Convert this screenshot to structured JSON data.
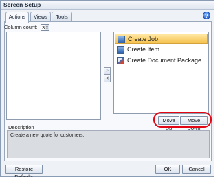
{
  "window": {
    "title": "Screen Setup"
  },
  "help_icon": "?",
  "tabs": [
    {
      "label": "Actions",
      "active": true
    },
    {
      "label": "Views",
      "active": false
    },
    {
      "label": "Tools",
      "active": false
    }
  ],
  "column_count": {
    "label": "Column count:",
    "value": "3"
  },
  "transfer_buttons": {
    "add": ">",
    "remove": "<"
  },
  "actions_list": [
    {
      "label": "Create Job",
      "icon": "create-job-icon",
      "selected": true
    },
    {
      "label": "Create Item",
      "icon": "create-item-icon",
      "selected": false
    },
    {
      "label": "Create Document Package",
      "icon": "document-package-icon",
      "selected": false
    }
  ],
  "order_buttons": {
    "move_up": "Move Up",
    "move_down": "Move Down"
  },
  "description": {
    "label": "Description",
    "text": "Create a new quote for customers."
  },
  "footer": {
    "restore": "Restore Defaults",
    "ok": "OK",
    "cancel": "Cancel"
  },
  "colors": {
    "highlight_ring": "#e30613",
    "selection": "#f5c04c"
  }
}
